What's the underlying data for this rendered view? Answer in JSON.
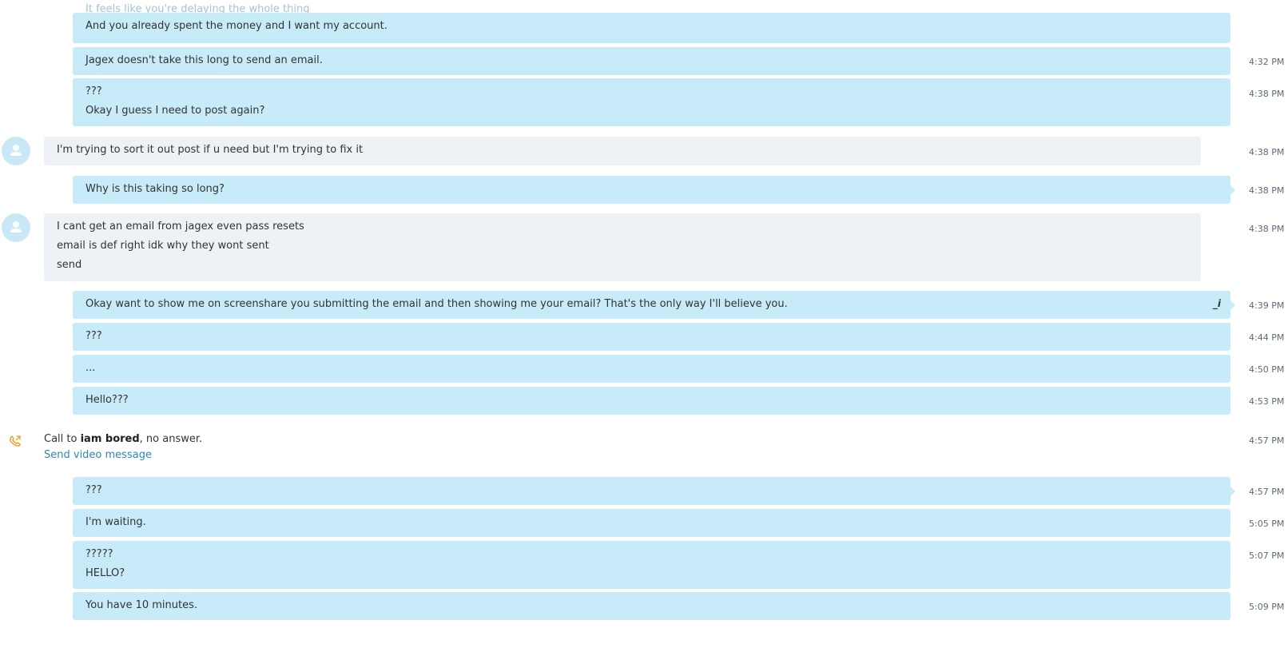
{
  "conversation": {
    "faded_top_text": "It feels like you're delaying the whole thing",
    "messages": [
      {
        "dir": "out",
        "lines": [
          "And you already spent the money and I want my account."
        ],
        "time": ""
      },
      {
        "dir": "out",
        "lines": [
          "Jagex doesn't take this long to send an email."
        ],
        "time": "4:32 PM"
      },
      {
        "dir": "out",
        "lines": [
          "???",
          "Okay I guess I need to post again?"
        ],
        "time": "4:38 PM"
      },
      {
        "dir": "in",
        "lines": [
          "I'm trying to sort it out post if u need but I'm trying to fix it"
        ],
        "time": "4:38 PM"
      },
      {
        "dir": "out",
        "lines": [
          "Why is this taking so long?"
        ],
        "time": "4:38 PM"
      },
      {
        "dir": "in",
        "lines": [
          "I cant get an email from jagex even pass resets",
          "email is def right idk why they wont sent",
          "send"
        ],
        "time": "4:38 PM"
      },
      {
        "dir": "out",
        "lines": [
          "Okay want to show me on screenshare you submitting the email and then showing me your email? That's the only way I'll believe you."
        ],
        "time": "4:39 PM",
        "edited_mark": "_i"
      },
      {
        "dir": "out",
        "lines": [
          "???"
        ],
        "time": "4:44 PM"
      },
      {
        "dir": "out",
        "lines": [
          "..."
        ],
        "time": "4:50 PM"
      },
      {
        "dir": "out",
        "lines": [
          "Hello???"
        ],
        "time": "4:53 PM"
      },
      {
        "dir": "out",
        "lines": [
          "???"
        ],
        "time": "4:57 PM"
      },
      {
        "dir": "out",
        "lines": [
          "I'm waiting."
        ],
        "time": "5:05 PM"
      },
      {
        "dir": "out",
        "lines": [
          "?????",
          "HELLO?"
        ],
        "time": "5:07 PM"
      },
      {
        "dir": "out",
        "lines": [
          "You have 10 minutes."
        ],
        "time": "5:09 PM"
      }
    ],
    "call_event": {
      "prefix": "Call to ",
      "contact": "iam bored",
      "suffix": ", no answer.",
      "link": "Send video message",
      "time": "4:57 PM",
      "icon": "phone-outgoing-icon"
    }
  },
  "colors": {
    "outgoing_bubble": "#c7ebf9",
    "incoming_bubble": "#eef1f5",
    "timestamp": "#5b6b7a",
    "link": "#2b86c5",
    "call_icon": "#f39a1c",
    "avatar": "#c9e8f7"
  }
}
